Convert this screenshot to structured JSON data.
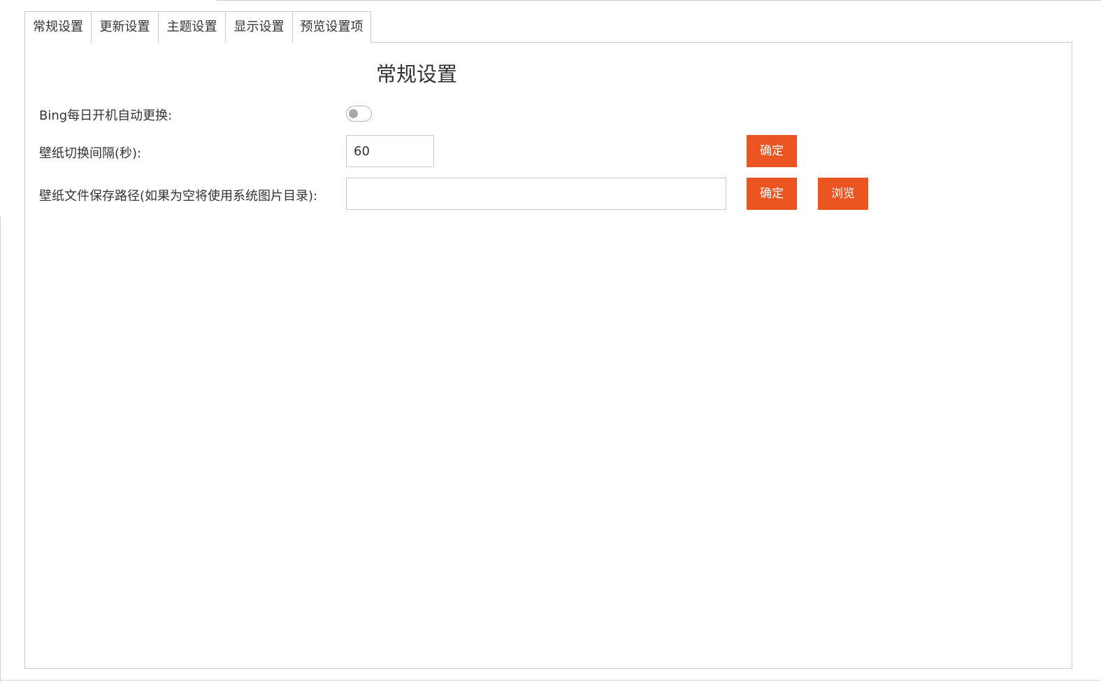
{
  "tabs": [
    {
      "label": "常规设置",
      "active": true
    },
    {
      "label": "更新设置",
      "active": false
    },
    {
      "label": "主题设置",
      "active": false
    },
    {
      "label": "显示设置",
      "active": false
    },
    {
      "label": "预览设置项",
      "active": false
    }
  ],
  "panel": {
    "title": "常规设置",
    "auto_change": {
      "label": "Bing每日开机自动更换:",
      "enabled": false
    },
    "interval": {
      "label": "壁纸切换间隔(秒):",
      "value": "60",
      "confirm_label": "确定"
    },
    "save_path": {
      "label": "壁纸文件保存路径(如果为空将使用系统图片目录):",
      "value": "",
      "confirm_label": "确定",
      "browse_label": "浏览"
    }
  },
  "colors": {
    "accent": "#e95420",
    "border": "#c9c9c9",
    "text": "#333333"
  }
}
